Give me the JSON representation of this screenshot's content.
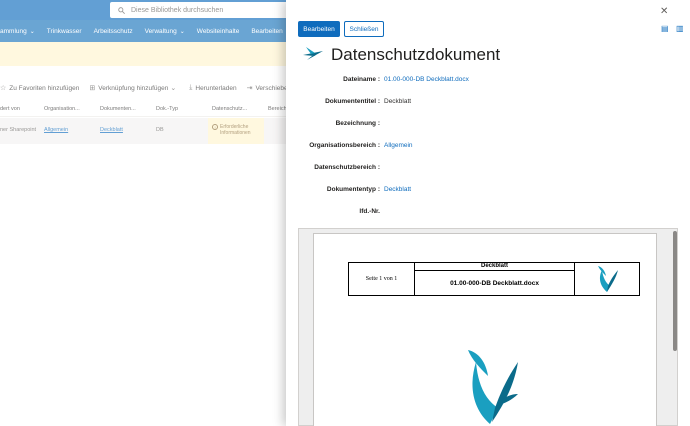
{
  "search": {
    "placeholder": "Diese Bibliothek durchsuchen"
  },
  "nav": {
    "items": [
      "ammlung",
      "Trinkwasser",
      "Arbeitsschutz",
      "Verwaltung",
      "Websiteinhalte",
      "Bearbeiten"
    ]
  },
  "commands": {
    "favorites": "Zu Favoriten hinzufügen",
    "shortcut": "Verknüpfung hinzufügen",
    "download": "Herunterladen",
    "move": "Verschieben nac"
  },
  "columns": [
    "dert von",
    "Organisation...",
    "Dokumenten...",
    "Dok.-Typ",
    "Datenschutz...",
    "Bereich"
  ],
  "row": {
    "col1": "ner Sharepoint",
    "col2": "Allgemein",
    "col3": "Deckblatt",
    "col4": "DB",
    "warning": "Erforderliche Informationen"
  },
  "panel": {
    "edit": "Bearbeiten",
    "close": "Schließen",
    "title": "Datenschutzdokument",
    "fields": [
      {
        "label": "Dateiname :",
        "value": "01.00-000-DB Deckblatt.docx"
      },
      {
        "label": "Dokumententitel :",
        "value": "Deckblatt"
      },
      {
        "label": "Bezeichnung :",
        "value": ""
      },
      {
        "label": "Organisationsbereich :",
        "value": "Allgemein"
      },
      {
        "label": "Datenschutzbereich :",
        "value": ""
      },
      {
        "label": "Dokumententyp :",
        "value": "Deckblatt"
      },
      {
        "label": "lfd.-Nr.",
        "value": ""
      }
    ]
  },
  "preview": {
    "page_info": "Seite 1 von 1",
    "doc_header": "Deckblatt",
    "doc_name": "01.00-000-DB  Deckblatt.docx"
  },
  "colors": {
    "brand": "#0f6cbd",
    "bird": "#1a9fc0",
    "bird_dark": "#0b6b8a"
  },
  "icons": [
    "search-icon",
    "star-icon",
    "link-icon",
    "download-icon",
    "move-icon",
    "close-icon",
    "file-icon",
    "bird-logo-icon"
  ]
}
